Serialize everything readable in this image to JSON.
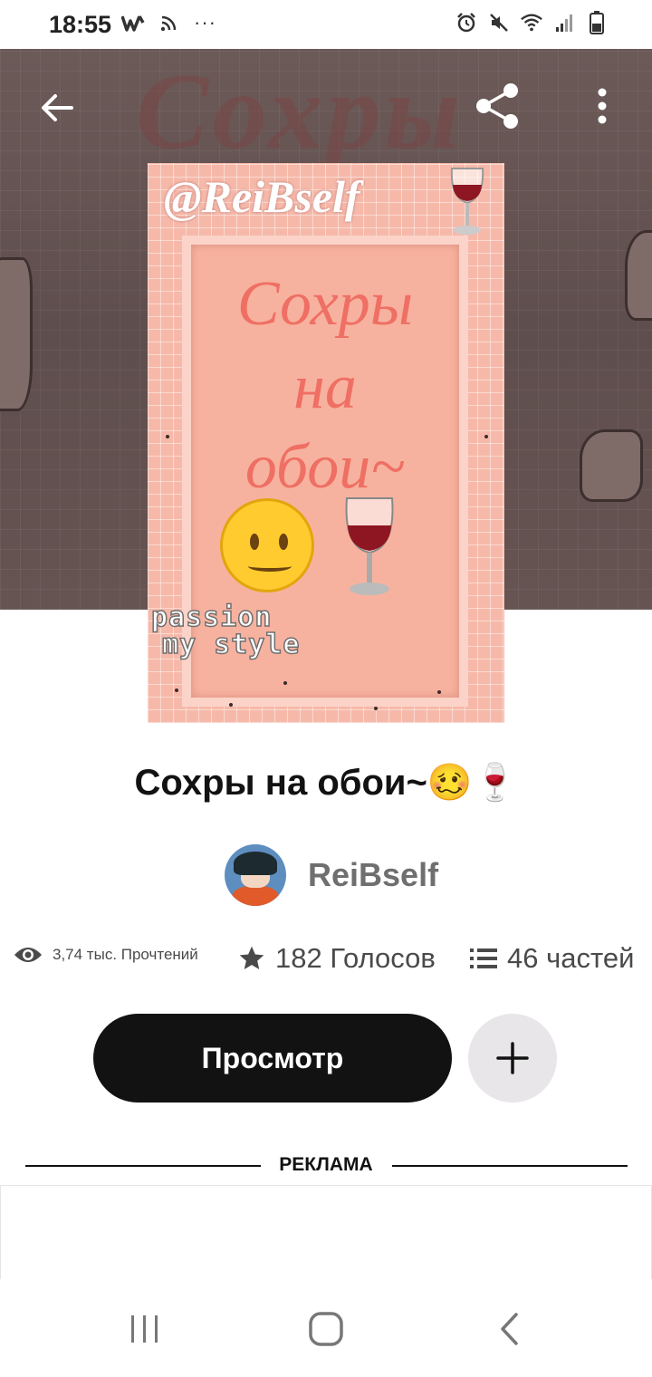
{
  "status_bar": {
    "time": "18:55",
    "left_icons": [
      "wattpad-icon",
      "cast-icon",
      "more-notifications-icon"
    ],
    "more_dots": "···",
    "right_icons": [
      "alarm-icon",
      "mute-icon",
      "wifi-icon",
      "signal-icon",
      "battery-icon"
    ]
  },
  "hero": {
    "background_word": "Сохры"
  },
  "cover": {
    "handle": "@ReiBself",
    "title_lines": [
      "Сохры",
      "на",
      "обои~"
    ],
    "caption_lines": [
      "passion",
      "my style"
    ],
    "colors": {
      "background": "#f6b9a9",
      "title": "#ef6f64"
    }
  },
  "story": {
    "title": "Сохры на обои~🥴🍷",
    "author": "ReiBself"
  },
  "stats": {
    "reads": "3,74 тыс. Прочтений",
    "votes": "182 Голосов",
    "parts": "46 частей"
  },
  "actions": {
    "read_label": "Просмотр"
  },
  "ad": {
    "label": "РЕКЛАМА"
  },
  "colors": {
    "primary_button": "#121212",
    "secondary_button": "#e8e6e8",
    "muted_text": "#6f6f6f"
  }
}
